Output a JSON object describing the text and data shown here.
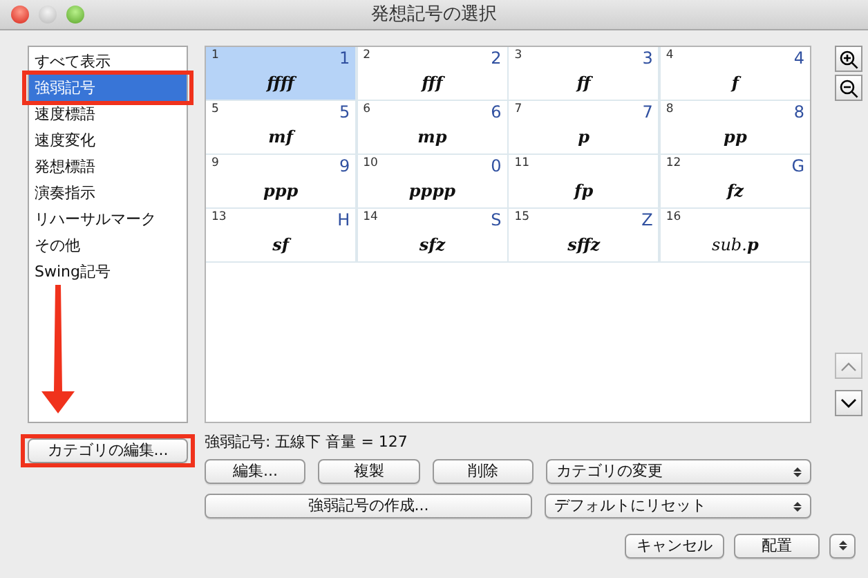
{
  "window": {
    "title": "発想記号の選択"
  },
  "categories": [
    {
      "label": "すべて表示",
      "selected": false,
      "highlighted": false
    },
    {
      "label": "強弱記号",
      "selected": true,
      "highlighted": true
    },
    {
      "label": "速度標語",
      "selected": false,
      "highlighted": false
    },
    {
      "label": "速度変化",
      "selected": false,
      "highlighted": false
    },
    {
      "label": "発想標語",
      "selected": false,
      "highlighted": false
    },
    {
      "label": "演奏指示",
      "selected": false,
      "highlighted": false
    },
    {
      "label": "リハーサルマーク",
      "selected": false,
      "highlighted": false
    },
    {
      "label": "その他",
      "selected": false,
      "highlighted": false
    },
    {
      "label": "Swing記号",
      "selected": false,
      "highlighted": false
    }
  ],
  "edit_categories_button": {
    "label": "カテゴリの編集...",
    "highlighted": true
  },
  "expressions": [
    {
      "number": "1",
      "shortcut": "1",
      "mark": "ffff",
      "selected": true
    },
    {
      "number": "2",
      "shortcut": "2",
      "mark": "fff",
      "selected": false
    },
    {
      "number": "3",
      "shortcut": "3",
      "mark": "ff",
      "selected": false
    },
    {
      "number": "4",
      "shortcut": "4",
      "mark": "f",
      "selected": false
    },
    {
      "number": "5",
      "shortcut": "5",
      "mark": "mf",
      "selected": false
    },
    {
      "number": "6",
      "shortcut": "6",
      "mark": "mp",
      "selected": false
    },
    {
      "number": "7",
      "shortcut": "7",
      "mark": "p",
      "selected": false
    },
    {
      "number": "8",
      "shortcut": "8",
      "mark": "pp",
      "selected": false
    },
    {
      "number": "9",
      "shortcut": "9",
      "mark": "ppp",
      "selected": false
    },
    {
      "number": "10",
      "shortcut": "0",
      "mark": "pppp",
      "selected": false
    },
    {
      "number": "11",
      "mark": "fp",
      "selected": false
    },
    {
      "number": "12",
      "shortcut": "G",
      "mark": "fz",
      "selected": false
    },
    {
      "number": "13",
      "shortcut": "H",
      "mark": "sf",
      "selected": false
    },
    {
      "number": "14",
      "shortcut": "S",
      "mark": "sfz",
      "selected": false
    },
    {
      "number": "15",
      "shortcut": "Z",
      "mark": "sffz",
      "selected": false
    },
    {
      "number": "16",
      "mark": "sub.**p**",
      "selected": false,
      "kind": "text"
    }
  ],
  "info": "強弱記号: 五線下 音量 = 127",
  "buttons": [
    "編集...",
    "複製",
    "削除"
  ],
  "change_category_select": "カテゴリの変更",
  "create_button": "強弱記号の作成...",
  "reset_select": "デフォルトにリセット",
  "footer_buttons": [
    "キャンセル",
    "配置"
  ]
}
